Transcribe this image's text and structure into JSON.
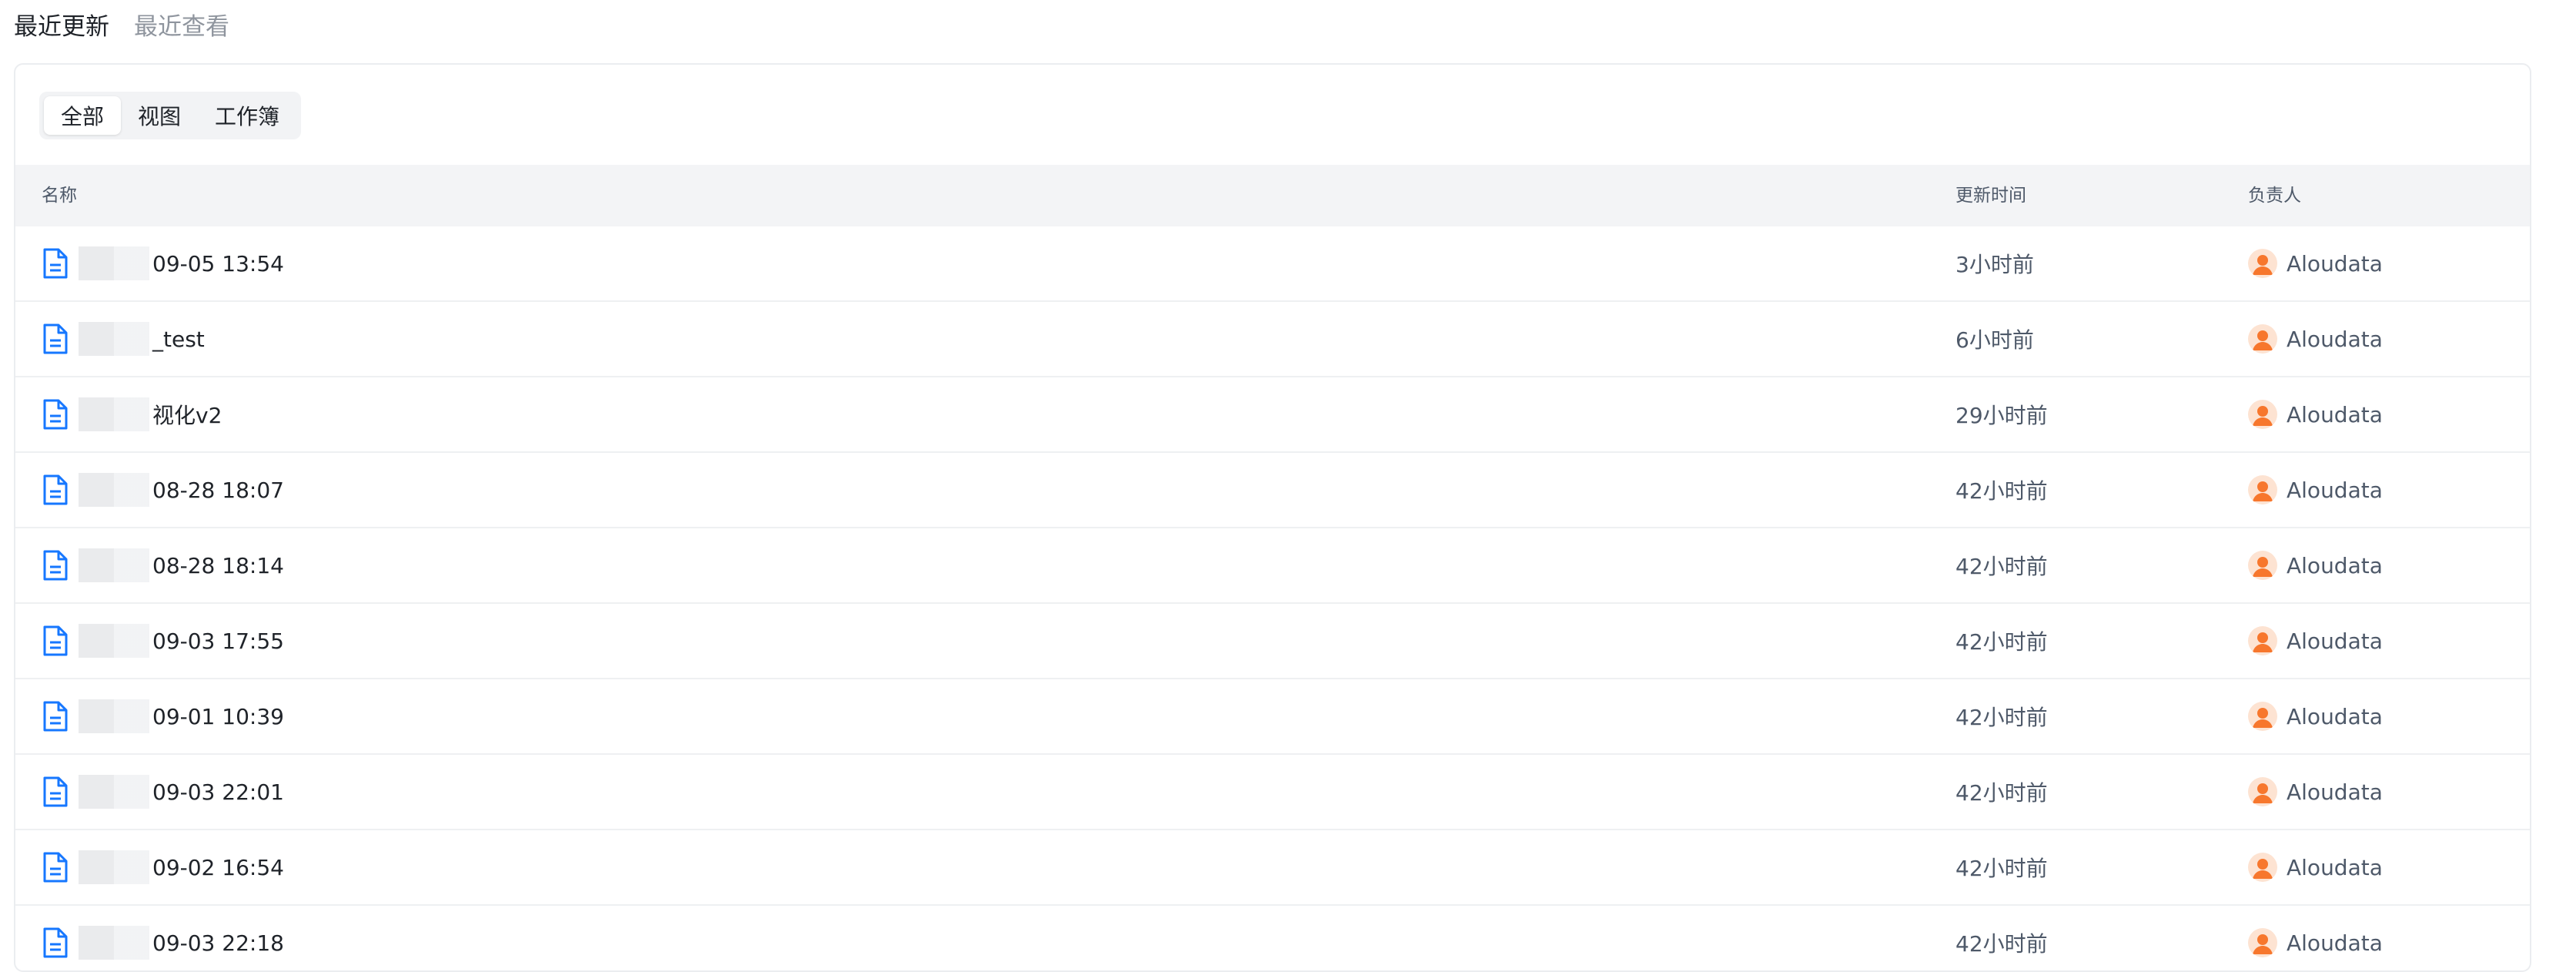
{
  "top_tabs": [
    {
      "label": "最近更新",
      "active": true
    },
    {
      "label": "最近查看",
      "active": false
    }
  ],
  "filter": [
    {
      "label": "全部",
      "active": true
    },
    {
      "label": "视图",
      "active": false
    },
    {
      "label": "工作簿",
      "active": false
    }
  ],
  "table": {
    "headers": {
      "name": "名称",
      "time": "更新时间",
      "owner": "负责人"
    },
    "rows": [
      {
        "name": "09-05 13:54",
        "time": "3小时前",
        "owner": "Aloudata"
      },
      {
        "name": "_test",
        "time": "6小时前",
        "owner": "Aloudata"
      },
      {
        "name": "视化v2",
        "time": "29小时前",
        "owner": "Aloudata"
      },
      {
        "name": "08-28 18:07",
        "time": "42小时前",
        "owner": "Aloudata"
      },
      {
        "name": "08-28 18:14",
        "time": "42小时前",
        "owner": "Aloudata"
      },
      {
        "name": "09-03 17:55",
        "time": "42小时前",
        "owner": "Aloudata"
      },
      {
        "name": "09-01 10:39",
        "time": "42小时前",
        "owner": "Aloudata"
      },
      {
        "name": "09-03 22:01",
        "time": "42小时前",
        "owner": "Aloudata"
      },
      {
        "name": "09-02 16:54",
        "time": "42小时前",
        "owner": "Aloudata"
      },
      {
        "name": "09-03 22:18",
        "time": "42小时前",
        "owner": "Aloudata"
      }
    ]
  },
  "icons": {
    "row_icon": "document-icon",
    "avatar_icon": "user-avatar-icon"
  },
  "colors": {
    "icon_blue": "#1677ff",
    "avatar_orange": "#f7772d",
    "header_bg": "#f3f4f6"
  }
}
